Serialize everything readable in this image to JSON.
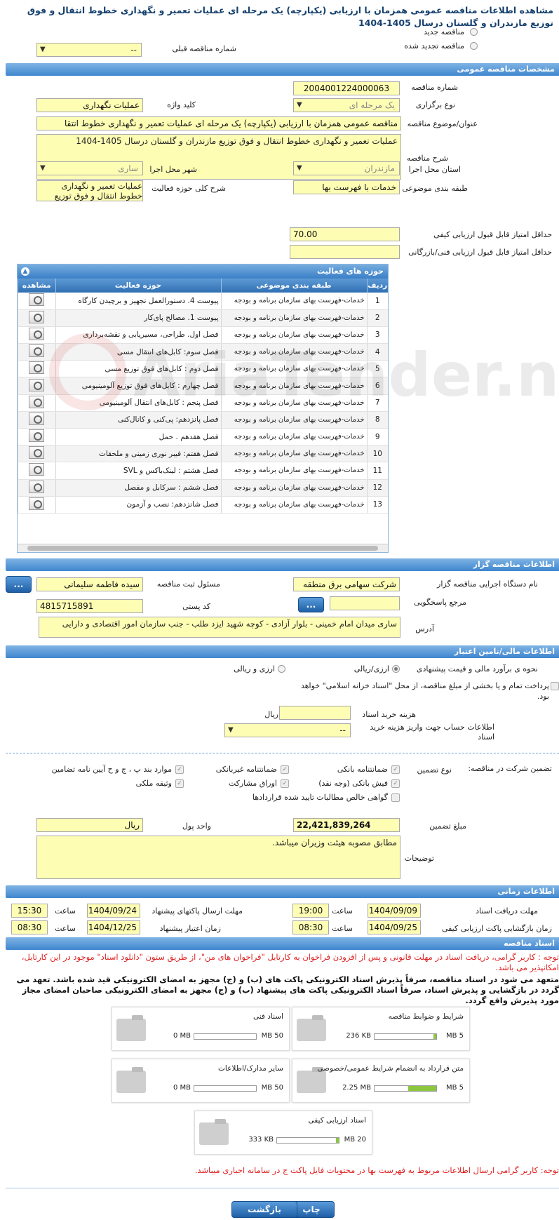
{
  "page_title": "مشاهده اطلاعات مناقصه عمومی همزمان با ارزیابی (یکپارچه) یک مرحله ای عملیات تعمیر و نگهداری خطوط انتقال و فوق توزیع مازندران و گلستان درسال 1405-1404",
  "radios": {
    "new": "مناقصه جدید",
    "renewed": "مناقصه تجدید شده",
    "prev_no_label": "شماره مناقصه قبلی",
    "prev_no_value": "--"
  },
  "sections": {
    "general": "مشخصات مناقصه عمومی",
    "organizer": "اطلاعات مناقصه گزار",
    "finance": "اطلاعات مالی/تامین اعتبار",
    "timing": "اطلاعات زمانی",
    "docs": "اسناد مناقصه"
  },
  "general": {
    "tender_no_label": "شماره مناقصه",
    "tender_no": "2004001224000063",
    "hold_type_label": "نوع برگزاری",
    "hold_type": "یک مرحله ای",
    "keyword_label": "کلید واژه",
    "keyword": "عملیات نگهداری",
    "subject_label": "عنوان/موضوع مناقصه",
    "subject": "مناقصه عمومی همزمان با ارزیابی (یکپارچه) یک مرحله ای عملیات تعمیر و نگهداری خطوط انتقا",
    "desc_label": "شرح مناقصه",
    "desc": "عملیات تعمیر و نگهداری خطوط انتقال و فوق توزیع مازندران و گلستان درسال 1405-1404",
    "province_label": "استان محل اجرا",
    "province": "مازندران",
    "city_label": "شهر محل اجرا",
    "city": "ساری",
    "category_label": "طبقه بندی موضوعی",
    "category": "خدمات با فهرست بها",
    "scope_label": "شرح کلی حوزه فعالیت",
    "scope": "عملیات تعمیر و نگهداری خطوط انتقال و فوق توزیع",
    "min_quality_label": "حداقل امتیاز قابل قبول ارزیابی کیفی",
    "min_quality": "70.00",
    "min_tech_label": "حداقل امتیاز قابل قبول ارزیابی فنی/بازرگانی",
    "min_tech": ""
  },
  "activity": {
    "title": "حوزه های فعالیت",
    "headers": {
      "row": "ردیف",
      "category": "طبقه بندی موضوعی",
      "field": "حوزه فعالیت",
      "view": "مشاهده"
    },
    "rows": [
      {
        "n": "1",
        "cat": "خدمات-فهرست بهای سازمان برنامه و بودجه",
        "field": "پیوست 4. دستورالعمل تجهیز و برچیدن کارگاه"
      },
      {
        "n": "2",
        "cat": "خدمات-فهرست بهای سازمان برنامه و بودجه",
        "field": "پیوست 1. مصالح پای‌کار"
      },
      {
        "n": "3",
        "cat": "خدمات-فهرست بهای سازمان برنامه و بودجه",
        "field": "فصل اول. طراحی، مسیریابی و نقشه‌برداری"
      },
      {
        "n": "4",
        "cat": "خدمات-فهرست بهای سازمان برنامه و بودجه",
        "field": "فصل سوم: کابل‌های انتقال مسی"
      },
      {
        "n": "5",
        "cat": "خدمات-فهرست بهای سازمان برنامه و بودجه",
        "field": "فصل دوم : کابل‌های فوق توزیع مسی"
      },
      {
        "n": "6",
        "cat": "خدمات-فهرست بهای سازمان برنامه و بودجه",
        "field": "فصل چهارم : کابل‌های فوق توزیع آلومینیومی"
      },
      {
        "n": "7",
        "cat": "خدمات-فهرست بهای سازمان برنامه و بودجه",
        "field": "فصل پنجم : کابل‌های انتقال آلومینیومی"
      },
      {
        "n": "8",
        "cat": "خدمات-فهرست بهای سازمان برنامه و بودجه",
        "field": "فصل پانزدهم: پی‌کنی و کانال‌کنی"
      },
      {
        "n": "9",
        "cat": "خدمات-فهرست بهای سازمان برنامه و بودجه",
        "field": "فصل هفدهم . حمل"
      },
      {
        "n": "10",
        "cat": "خدمات-فهرست بهای سازمان برنامه و بودجه",
        "field": "فصل هفتم: فیبر نوری زمینی و ملحقات"
      },
      {
        "n": "11",
        "cat": "خدمات-فهرست بهای سازمان برنامه و بودجه",
        "field": "فصل هشتم : لینک‌باکس و SVL"
      },
      {
        "n": "12",
        "cat": "خدمات-فهرست بهای سازمان برنامه و بودجه",
        "field": "فصل ششم : سرکابل و مفصل"
      },
      {
        "n": "13",
        "cat": "خدمات-فهرست بهای سازمان برنامه و بودجه",
        "field": "فصل شانزدهم: نصب و آزمون"
      }
    ]
  },
  "organizer": {
    "device_label": "نام دستگاه اجرایی مناقصه گزار",
    "device": "شرکت سهامی برق منطقه",
    "responsible_label": "مسئول ثبت مناقصه",
    "responsible": "سیده فاطمه سلیمانی",
    "more_btn": "...",
    "ref_label": "مرجع پاسخگویی",
    "ref": "",
    "ref_btn": "...",
    "postal_label": "کد پستی",
    "postal": "4815715891",
    "address_label": "آدرس",
    "address": "ساری میدان امام خمینی - بلوار آزادی - کوچه شهید ایزد طلب - جنب سازمان امور اقتصادی و دارایی"
  },
  "finance": {
    "estimate_label": "نحوه ی برآورد مالی و قیمت پیشنهادی",
    "opt1": "ارزی/ریالی",
    "opt2": "ارزی و ریالی",
    "treasury_text": "پرداخت تمام و یا بخشی از مبلغ مناقصه، از محل \"اسناد خزانه اسلامی\" خواهد بود.",
    "doc_fee_label": "هزینه خرید اسناد",
    "doc_fee": "",
    "doc_fee_unit": "ریال",
    "account_label": "اطلاعات حساب جهت واریز هزینه خرید اسناد",
    "account": "--"
  },
  "guarantee": {
    "participation_label": "تضمین شرکت در مناقصه:",
    "type_label": "نوع تضمین",
    "items": [
      "ضمانتنامه بانکی",
      "ضمانتنامه غیربانکی",
      "موارد بند پ ، ج و ح آیین نامه تضامین",
      "فیش بانکی (وجه نقد)",
      "اوراق مشارکت",
      "وثیقه ملکی",
      "گواهی خالص مطالبات تایید شده قراردادها"
    ],
    "amount_label": "مبلغ تضمین",
    "amount": "22,421,839,264",
    "currency_label": "واحد پول",
    "currency": "ریال",
    "notes_label": "توضیحات",
    "notes": "مطابق مصوبه هیئت وزیران میباشد."
  },
  "timing": {
    "receive_label": "مهلت دریافت اسناد",
    "receive_date": "1404/09/09",
    "receive_time": "19:00",
    "submit_label": "مهلت ارسال پاکتهای پیشنهاد",
    "submit_date": "1404/09/24",
    "submit_time": "15:30",
    "open_label": "زمان بازگشایی پاکت ارزیابی کیفی",
    "open_date": "1404/09/25",
    "open_time": "08:30",
    "valid_label": "زمان اعتبار پیشنهاد",
    "valid_date": "1404/12/25",
    "valid_time": "08:30",
    "time_label": "ساعت"
  },
  "docs": {
    "notice1": "توجه : کاربر گرامی، دریافت اسناد در مهلت قانونی و پس از افزودن فراخوان به کارتابل \"فراخوان های من\"، از طریق ستون \"دانلود اسناد\" موجود در این کارتابل، امکانپذیر می باشد.",
    "notice2": "متعهد می شود در اسناد مناقصه، صرفاً پذیرش اسناد الکترونیکی پاکت های (ب) و (ج) مجهز به امضای الکترونیکی قید شده باشد. تعهد می گردد در بازگشایی و پذیرش اسناد، صرفاً اسناد الکترونیکی پاکت های پیشنهاد (ب) و (ج) مجهز به امضای الکترونیکی صاحبان امضای مجاز مورد پذیرش واقع گردد.",
    "files": [
      {
        "name": "شرایط و ضوابط مناقصه",
        "size": "236 KB",
        "max": "5 MB",
        "fill": 0.05
      },
      {
        "name": "اسناد فنی",
        "size": "0 MB",
        "max": "50 MB",
        "fill": 0
      },
      {
        "name": "متن قرارداد به انضمام شرایط عمومی/خصوصی",
        "size": "2.25 MB",
        "max": "5 MB",
        "fill": 0.45
      },
      {
        "name": "سایر مدارک/اطلاعات",
        "size": "0 MB",
        "max": "50 MB",
        "fill": 0
      },
      {
        "name": "اسناد ارزیابی کیفی",
        "size": "333 KB",
        "max": "20 MB",
        "fill": 0.02
      }
    ],
    "notice3": "توجه: کاربر گرامی ارسال اطلاعات مربوط به فهرست بها در محتویات فایل پاکت ج در سامانه اجباری میباشد."
  },
  "buttons": {
    "print": "چاپ",
    "back": "بازگشت"
  },
  "watermark": "AriaTender.neT"
}
